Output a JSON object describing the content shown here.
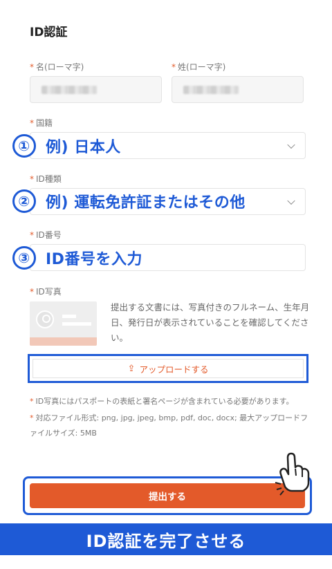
{
  "page": {
    "title": "ID認証"
  },
  "form": {
    "first_name": {
      "label": "名(ローマ字)"
    },
    "last_name": {
      "label": "姓(ローマ字)"
    },
    "nationality": {
      "label": "国籍"
    },
    "id_type": {
      "label": "ID種類"
    },
    "id_number": {
      "label": "ID番号"
    },
    "id_photo": {
      "label": "ID写真",
      "description": "提出する文書には、写真付きのフルネーム、生年月日、発行日が表示されていることを確認してください。",
      "upload_label": "アップロードする",
      "upload_icon": "upload-icon"
    },
    "notes": [
      "ID写真にはパスポートの表紙と署名ページが含まれている必要があります。",
      "対応ファイル形式: png, jpg, jpeg, bmp, pdf, doc, docx; 最大アップロードファイルサイズ: 5MB"
    ],
    "submit_label": "提出する",
    "required_mark": "*"
  },
  "annotations": {
    "step1": {
      "number": "①",
      "text": "例) 日本人"
    },
    "step2": {
      "number": "②",
      "text": "例) 運転免許証またはその他"
    },
    "step3": {
      "number": "③",
      "text": "ID番号を入力"
    },
    "banner": "ID認証を完了させる"
  },
  "colors": {
    "accent": "#e35a2a",
    "annotation_blue": "#1e5ad6"
  }
}
